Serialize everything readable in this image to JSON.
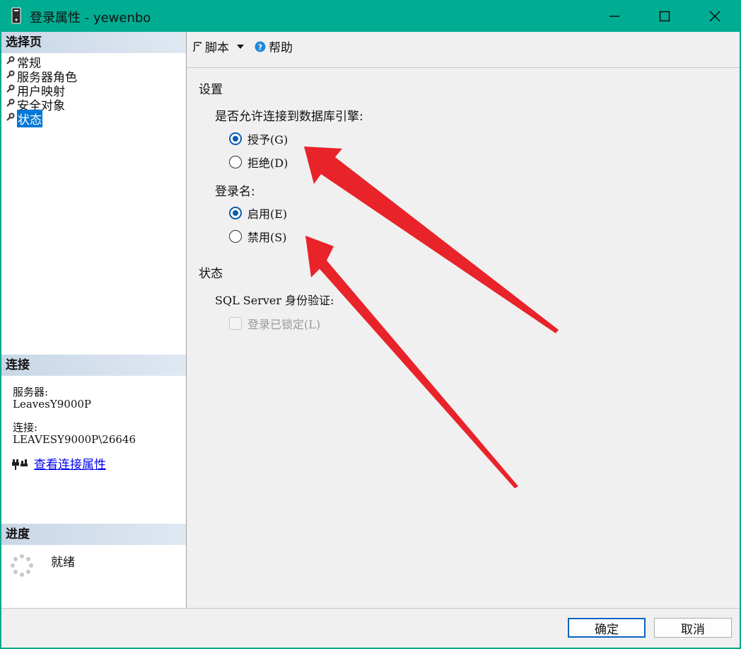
{
  "window": {
    "title": "登录属性 - yewenbo"
  },
  "sidebar": {
    "select_page_header": "选择页",
    "items": [
      {
        "label": "常规"
      },
      {
        "label": "服务器角色"
      },
      {
        "label": "用户映射"
      },
      {
        "label": "安全对象"
      },
      {
        "label": "状态",
        "selected": true
      }
    ],
    "connection_header": "连接",
    "server_label": "服务器:",
    "server_value": "LeavesY9000P",
    "connection_label": "连接:",
    "connection_value": "LEAVESY9000P\\26646",
    "view_connection_link": "查看连接属性",
    "progress_header": "进度",
    "progress_status": "就绪"
  },
  "toolbar": {
    "script_label": "脚本",
    "help_label": "帮助"
  },
  "settings": {
    "section_title": "设置",
    "db_engine_question": "是否允许连接到数据库引擎:",
    "grant_label": "授予(G)",
    "deny_label": "拒绝(D)",
    "login_label": "登录名:",
    "enable_label": "启用(E)",
    "disable_label": "禁用(S)",
    "grant_selected": true,
    "enable_selected": true
  },
  "status": {
    "section_title": "状态",
    "sql_auth_label": "SQL Server 身份验证:",
    "locked_label": "登录已锁定(L)"
  },
  "footer": {
    "ok_label": "确定",
    "cancel_label": "取消"
  },
  "colors": {
    "titlebar": "#00ad92",
    "accent_radio": "#0a5bb0",
    "arrow": "#e8232a",
    "selection": "#0078d7"
  }
}
